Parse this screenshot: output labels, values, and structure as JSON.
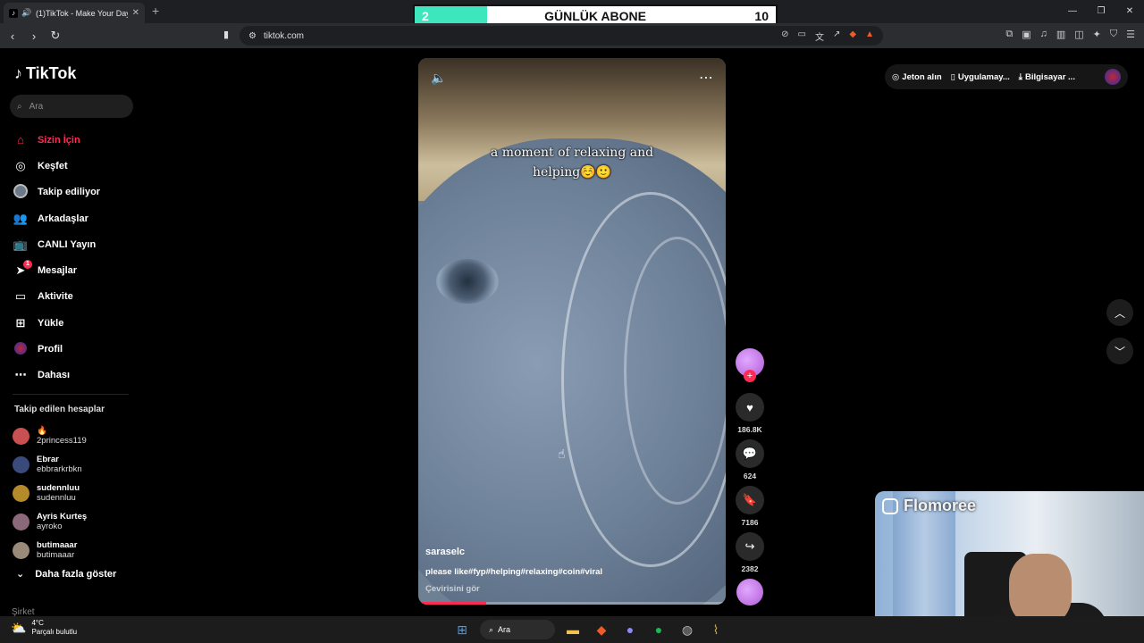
{
  "browser": {
    "tab_title": "(1)TikTok - Make Your Day",
    "url": "tiktok.com"
  },
  "overlay": {
    "left_value": "2",
    "title": "GÜNLÜK ABONE",
    "right_value": "10",
    "progress_fraction": 0.2,
    "accent": "#3ee6bd"
  },
  "sidebar": {
    "logo": "TikTok",
    "search_placeholder": "Ara",
    "nav": [
      {
        "label": "Sizin İçin",
        "icon": "home-icon",
        "active": true
      },
      {
        "label": "Keşfet",
        "icon": "compass-icon"
      },
      {
        "label": "Takip ediliyor",
        "icon": "following-avatar-icon"
      },
      {
        "label": "Arkadaşlar",
        "icon": "friends-icon"
      },
      {
        "label": "CANLI Yayın",
        "icon": "live-icon"
      },
      {
        "label": "Mesajlar",
        "icon": "messages-icon",
        "badge": "1"
      },
      {
        "label": "Aktivite",
        "icon": "activity-icon"
      },
      {
        "label": "Yükle",
        "icon": "upload-icon"
      },
      {
        "label": "Profil",
        "icon": "profile-icon"
      },
      {
        "label": "Dahası",
        "icon": "more-icon"
      }
    ],
    "following_title": "Takip edilen hesaplar",
    "accounts": [
      {
        "name": "🔥",
        "handle": "2princess119",
        "color": "#c85050"
      },
      {
        "name": "Ebrar",
        "handle": "ebbrarkrbkn",
        "color": "#3a4a7a"
      },
      {
        "name": "sudennluu",
        "handle": "sudennluu",
        "color": "#b58a2a"
      },
      {
        "name": "Ayris Kurteş",
        "handle": "ayroko",
        "color": "#8a6a7a"
      },
      {
        "name": "butimaaar",
        "handle": "butimaaar",
        "color": "#9a8a7a"
      }
    ],
    "show_more": "Daha fazla göster",
    "company": "Şirket"
  },
  "video": {
    "overlay_caption": "a moment of relaxing and helping☺️🙂",
    "author": "saraselc",
    "description": "please like#fyp#helping#relaxing#coin#viral",
    "translate": "Çevirisini gör",
    "progress_fraction": 0.22
  },
  "actions": {
    "likes": "186.8K",
    "comments": "624",
    "saves": "7186",
    "shares": "2382"
  },
  "top_right": {
    "coins": "Jeton alın",
    "app": "Uygulamay...",
    "desktop": "Bilgisayar ..."
  },
  "webcam": {
    "name": "Flomoree"
  },
  "taskbar": {
    "temp": "4°C",
    "weather": "Parçalı bulutlu",
    "search": "Ara"
  }
}
